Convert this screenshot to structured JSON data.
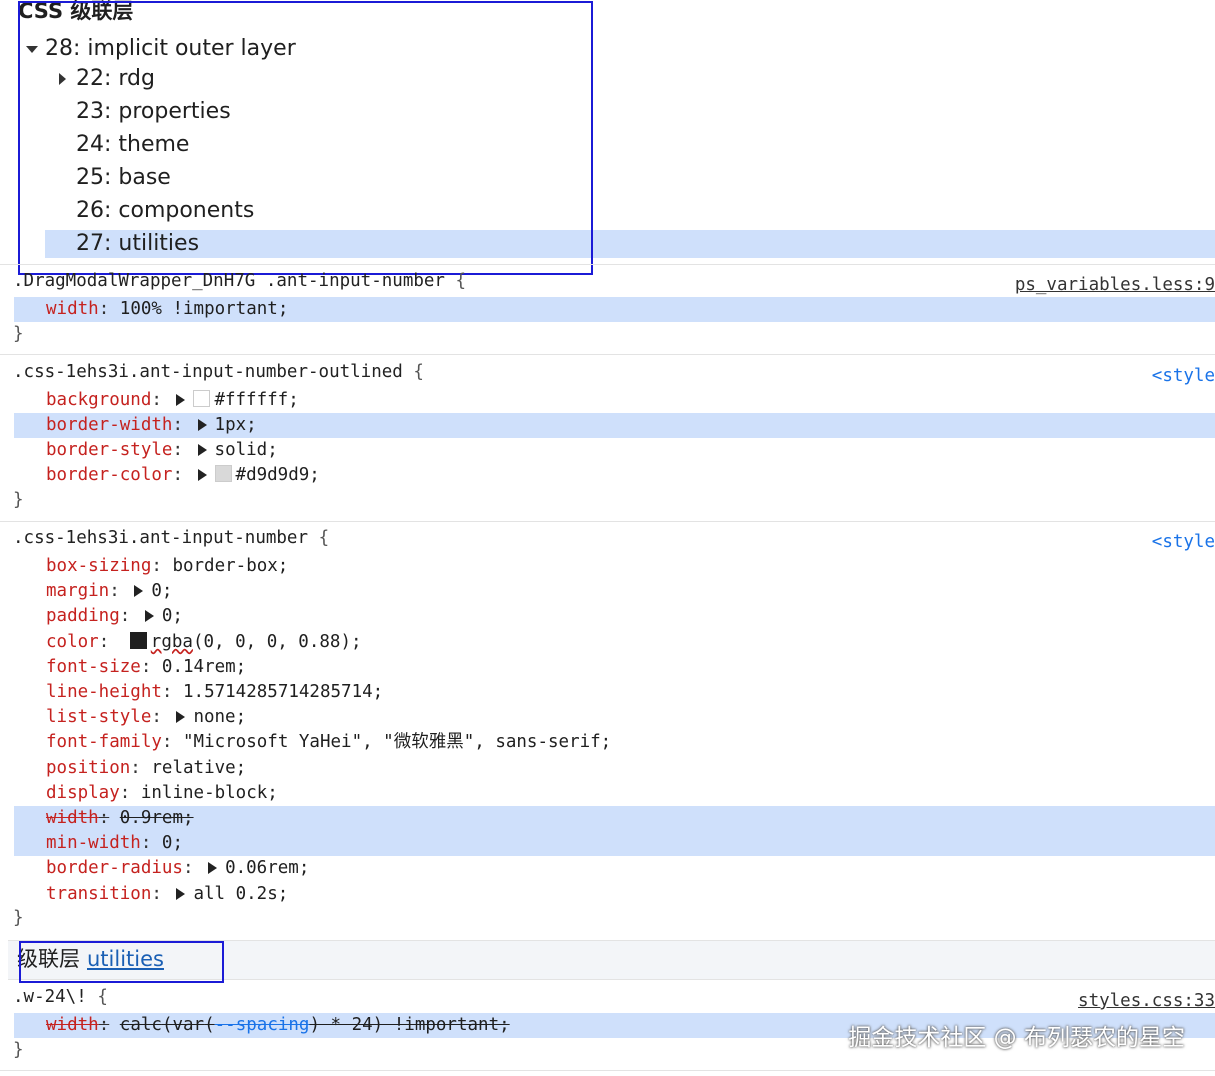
{
  "cascade_layers": {
    "title": "CSS 级联层",
    "root": {
      "label": "28: implicit outer layer",
      "expanded": true
    },
    "items": [
      {
        "label": "22: rdg",
        "collapsed": true
      },
      {
        "label": "23: properties"
      },
      {
        "label": "24: theme"
      },
      {
        "label": "25: base"
      },
      {
        "label": "26: components"
      },
      {
        "label": "27: utilities",
        "selected": true
      }
    ]
  },
  "rules": [
    {
      "selector": ".DragModalWrapper_DnH7G .ant-input-number",
      "source": "ps_variables.less:9",
      "props": [
        {
          "name": "width",
          "value": "100% !important;"
        }
      ]
    },
    {
      "selector": ".css-1ehs3i.ant-input-number-outlined",
      "source": "<style",
      "props": [
        {
          "name": "background",
          "value": "#ffffff;",
          "swatch": "#ffffff"
        },
        {
          "name": "border-width",
          "value": "1px;"
        },
        {
          "name": "border-style",
          "value": "solid;"
        },
        {
          "name": "border-color",
          "value": "#d9d9d9;",
          "swatch": "#d9d9d9"
        }
      ]
    },
    {
      "selector": ".css-1ehs3i.ant-input-number",
      "source": "<style",
      "props": [
        {
          "name": "box-sizing",
          "value": "border-box;"
        },
        {
          "name": "margin",
          "value": "0;"
        },
        {
          "name": "padding",
          "value": "0;"
        },
        {
          "name": "color",
          "value_fn": "rgba",
          "value": "(0, 0, 0, 0.88);",
          "swatch": "#1f1f1f"
        },
        {
          "name": "font-size",
          "value": "0.14rem;"
        },
        {
          "name": "line-height",
          "value": "1.5714285714285714;"
        },
        {
          "name": "list-style",
          "value": "none;"
        },
        {
          "name": "font-family",
          "value": "\"Microsoft YaHei\", \"微软雅黑\", sans-serif;"
        },
        {
          "name": "position",
          "value": "relative;"
        },
        {
          "name": "display",
          "value": "inline-block;"
        },
        {
          "name": "width",
          "value": "0.9rem;"
        },
        {
          "name": "min-width",
          "value": "0;"
        },
        {
          "name": "border-radius",
          "value": "0.06rem;"
        },
        {
          "name": "transition",
          "value": "all 0.2s;"
        }
      ]
    },
    {
      "selector": ".w-24\\!",
      "source": "styles.css:33",
      "props": [
        {
          "name": "width",
          "value_fn": "calc",
          "value_mid": "(",
          "value_fn2": "var",
          "value_mid2": "(",
          "value_var": "--spacing",
          "value": ") * 24) !important;"
        }
      ]
    }
  ],
  "layer_header": {
    "prefix": "级联层",
    "link": "utilities"
  },
  "closing_brace": "}",
  "open_brace": "{",
  "colon": ":",
  "watermark": "掘金技术社区 @ 布列瑟农的星空"
}
